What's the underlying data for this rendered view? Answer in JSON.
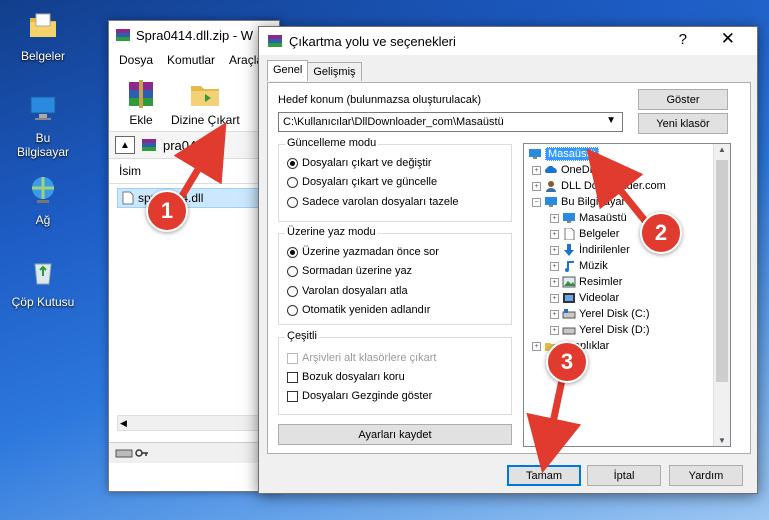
{
  "desktop": {
    "icons": [
      {
        "label": "Belgeler",
        "icon": "folder-icon"
      },
      {
        "label": "Bu Bilgisayar",
        "icon": "computer-icon"
      },
      {
        "label": "Ağ",
        "icon": "network-icon"
      },
      {
        "label": "Çöp Kutusu",
        "icon": "recycle-bin-icon"
      }
    ]
  },
  "winrar": {
    "title": "Spra0414.dll.zip - W",
    "menu": [
      "Dosya",
      "Komutlar",
      "Araçla"
    ],
    "toolbar": {
      "add": "Ekle",
      "extract_to": "Dizine Çıkart"
    },
    "path": "pra0414.dl",
    "list_header": "İsim",
    "file": "spra0414.dll"
  },
  "dialog": {
    "title": "Çıkartma yolu ve seçenekleri",
    "help": "?",
    "close": "✕",
    "tabs": [
      "Genel",
      "Gelişmiş"
    ],
    "dest_label": "Hedef konum (bulunmazsa oluşturulacak)",
    "dest_value": "C:\\Kullanıcılar\\DllDownloader_com\\Masaüstü",
    "show_button": "Göster",
    "new_folder_button": "Yeni klasör",
    "update_mode": {
      "title": "Güncelleme modu",
      "options": [
        "Dosyaları çıkart ve değiştir",
        "Dosyaları çıkart ve güncelle",
        "Sadece varolan dosyaları tazele"
      ],
      "selected": 0
    },
    "overwrite_mode": {
      "title": "Üzerine yaz modu",
      "options": [
        "Üzerine yazmadan önce sor",
        "Sormadan üzerine yaz",
        "Varolan dosyaları atla",
        "Otomatik yeniden adlandır"
      ],
      "selected": 0
    },
    "misc": {
      "title": "Çeşitli",
      "options": [
        "Arşivleri alt klasörlere çıkart",
        "Bozuk dosyaları koru",
        "Dosyaları Gezginde göster"
      ],
      "disabled_first": true
    },
    "save_settings_button": "Ayarları kaydet",
    "tree": [
      {
        "label": "Masaüstü",
        "level": 0,
        "icon": "desktop-icon",
        "selected": true
      },
      {
        "label": "OneDrive",
        "level": 1,
        "icon": "cloud-icon"
      },
      {
        "label": "DLL Downloader.com",
        "level": 1,
        "icon": "user-icon"
      },
      {
        "label": "Bu Bilgisayar",
        "level": 1,
        "icon": "computer-icon"
      },
      {
        "label": "Masaüstü",
        "level": 2,
        "icon": "desktop-icon"
      },
      {
        "label": "Belgeler",
        "level": 2,
        "icon": "document-icon"
      },
      {
        "label": "İndirilenler",
        "level": 2,
        "icon": "download-icon"
      },
      {
        "label": "Müzik",
        "level": 2,
        "icon": "music-icon"
      },
      {
        "label": "Resimler",
        "level": 2,
        "icon": "picture-icon"
      },
      {
        "label": "Videolar",
        "level": 2,
        "icon": "video-icon"
      },
      {
        "label": "Yerel Disk (C:)",
        "level": 2,
        "icon": "disk-icon"
      },
      {
        "label": "Yerel Disk (D:)",
        "level": 2,
        "icon": "disk-icon"
      },
      {
        "label": "Kitaplıklar",
        "level": 1,
        "icon": "library-icon"
      }
    ],
    "ok_button": "Tamam",
    "cancel_button": "İptal",
    "help_button": "Yardım"
  },
  "markers": [
    "1",
    "2",
    "3"
  ],
  "colors": {
    "marker": "#e03b2e",
    "selection": "#3399ff",
    "accent_ok": "#0078d7"
  }
}
